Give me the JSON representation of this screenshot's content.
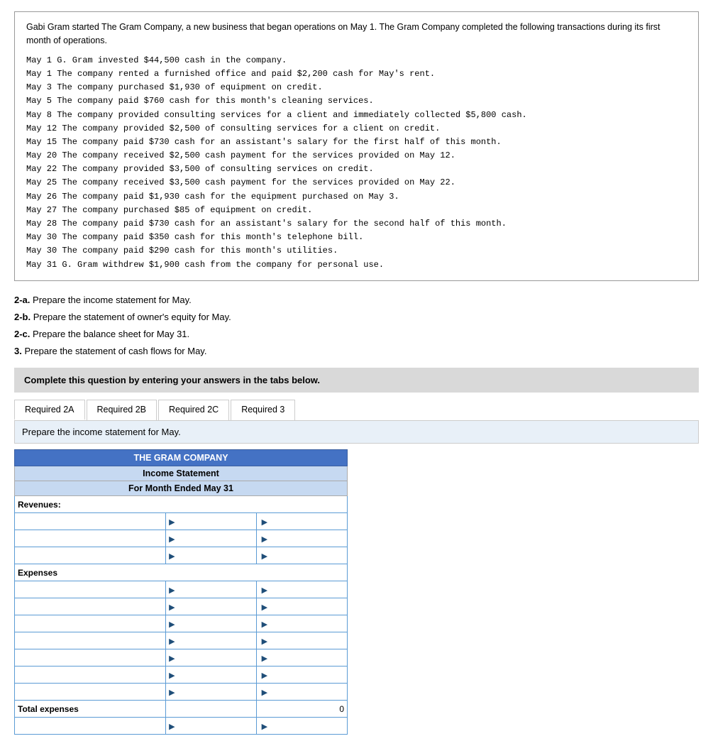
{
  "problem": {
    "intro": "Gabi Gram started The Gram Company, a new business that began operations on May 1. The Gram Company completed the following transactions during its first month of operations.",
    "transactions": [
      "May  1  G. Gram invested $44,500 cash in the company.",
      "May  1  The company rented a furnished office and paid $2,200 cash for May's rent.",
      "May  3  The company purchased $1,930 of equipment on credit.",
      "May  5  The company paid $760 cash for this month's cleaning services.",
      "May  8  The company provided consulting services for a client and immediately collected $5,800 cash.",
      "May 12  The company provided $2,500 of consulting services for a client on credit.",
      "May 15  The company paid $730 cash for an assistant's salary for the first half of this month.",
      "May 20  The company received $2,500 cash payment for the services provided on May 12.",
      "May 22  The company provided $3,500 of consulting services on credit.",
      "May 25  The company received $3,500 cash payment for the services provided on May 22.",
      "May 26  The company paid $1,930 cash for the equipment purchased on May 3.",
      "May 27  The company purchased $85 of equipment on credit.",
      "May 28  The company paid $730 cash for an assistant's salary for the second half of this month.",
      "May 30  The company paid $350 cash for this month's telephone bill.",
      "May 30  The company paid $290 cash for this month's utilities.",
      "May 31  G. Gram withdrew $1,900 cash from the company for personal use."
    ]
  },
  "questions": [
    {
      "label": "2-a.",
      "bold": true,
      "text": " Prepare the income statement for May."
    },
    {
      "label": "2-b.",
      "bold": true,
      "text": " Prepare the statement of owner's equity for May."
    },
    {
      "label": "2-c.",
      "bold": true,
      "text": " Prepare the balance sheet for May 31."
    },
    {
      "label": "3.",
      "bold": true,
      "text": " Prepare the statement of cash flows for May."
    }
  ],
  "instruction_bar": "Complete this question by entering your answers in the tabs below.",
  "tabs": [
    {
      "id": "req2a",
      "label": "Required 2A",
      "active": true
    },
    {
      "id": "req2b",
      "label": "Required 2B",
      "active": false
    },
    {
      "id": "req2c",
      "label": "Required 2C",
      "active": false
    },
    {
      "id": "req3",
      "label": "Required 3",
      "active": false
    }
  ],
  "tab_instruction": "Prepare the income statement for May.",
  "table": {
    "company_name": "THE GRAM COMPANY",
    "statement_name": "Income Statement",
    "period": "For Month Ended May 31",
    "sections": [
      {
        "type": "section-label",
        "label": "Revenues:"
      },
      {
        "type": "data-row",
        "label": "",
        "mid": "",
        "value": ""
      },
      {
        "type": "data-row",
        "label": "",
        "mid": "",
        "value": ""
      },
      {
        "type": "data-row",
        "label": "",
        "mid": "",
        "value": ""
      },
      {
        "type": "section-label",
        "label": "Expenses"
      },
      {
        "type": "data-row",
        "label": "",
        "mid": "",
        "value": ""
      },
      {
        "type": "data-row",
        "label": "",
        "mid": "",
        "value": ""
      },
      {
        "type": "data-row",
        "label": "",
        "mid": "",
        "value": ""
      },
      {
        "type": "data-row",
        "label": "",
        "mid": "",
        "value": ""
      },
      {
        "type": "data-row",
        "label": "",
        "mid": "",
        "value": ""
      },
      {
        "type": "data-row",
        "label": "",
        "mid": "",
        "value": ""
      },
      {
        "type": "data-row",
        "label": "",
        "mid": "",
        "value": ""
      },
      {
        "type": "total-row",
        "label": "Total expenses",
        "mid": "",
        "value": "0"
      },
      {
        "type": "data-row",
        "label": "",
        "mid": "",
        "value": ""
      }
    ]
  }
}
